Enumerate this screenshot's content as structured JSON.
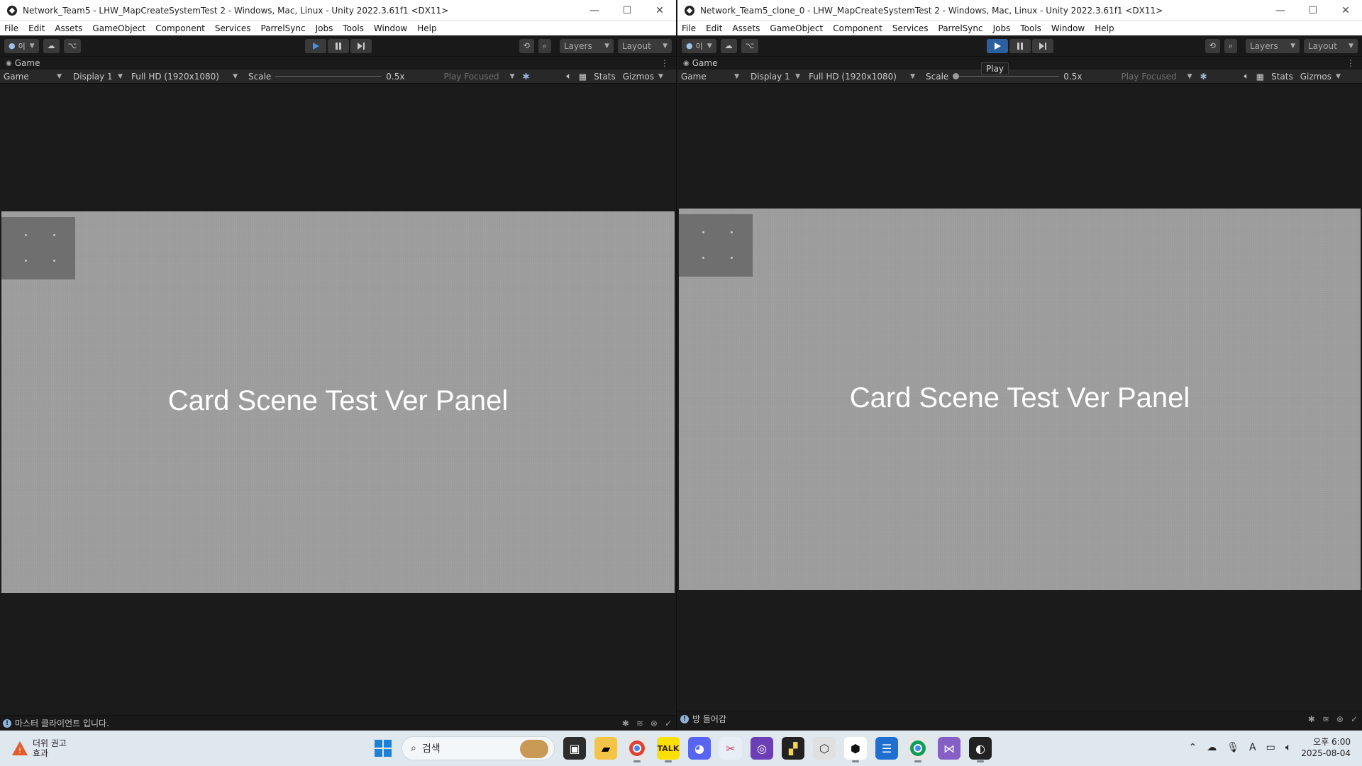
{
  "windows": [
    {
      "title": "Network_Team5 - LHW_MapCreateSystemTest 2 - Windows, Mac, Linux - Unity 2022.3.61f1 <DX11>",
      "menu": [
        "File",
        "Edit",
        "Assets",
        "GameObject",
        "Component",
        "Services",
        "ParrelSync",
        "Jobs",
        "Tools",
        "Window",
        "Help"
      ],
      "account_label": "이",
      "layers_label": "Layers",
      "layout_label": "Layout",
      "tab_label": "Game",
      "game_dropdown": "Game",
      "display": "Display 1",
      "resolution": "Full HD (1920x1080)",
      "scale_label": "Scale",
      "scale_value": "0.5x",
      "play_focused": "Play Focused",
      "stats_label": "Stats",
      "gizmos_label": "Gizmos",
      "panel_text": "Card Scene Test Ver Panel",
      "status_message": "마스터 클라이언트 입니다.",
      "play_active": false
    },
    {
      "title": "Network_Team5_clone_0 - LHW_MapCreateSystemTest 2 - Windows, Mac, Linux - Unity 2022.3.61f1 <DX11>",
      "menu": [
        "File",
        "Edit",
        "Assets",
        "GameObject",
        "Component",
        "Services",
        "ParrelSync",
        "Jobs",
        "Tools",
        "Window",
        "Help"
      ],
      "account_label": "이",
      "layers_label": "Layers",
      "layout_label": "Layout",
      "tab_label": "Game",
      "game_dropdown": "Game",
      "display": "Display 1",
      "resolution": "Full HD (1920x1080)",
      "scale_label": "Scale",
      "scale_value": "0.5x",
      "play_focused": "Play Focused",
      "stats_label": "Stats",
      "gizmos_label": "Gizmos",
      "panel_text": "Card Scene Test Ver Panel",
      "status_message": "방 들어감",
      "play_active": true
    }
  ],
  "tooltip": "Play",
  "taskbar": {
    "weather_line1": "더위 권고",
    "weather_line2": "효과",
    "search_placeholder": "검색",
    "time": "오후 6:00",
    "date": "2025-08-04"
  },
  "colors": {
    "play_active": "#2a5fa0",
    "panel_bg": "#9b9b9b",
    "editor_bg": "#191919"
  }
}
